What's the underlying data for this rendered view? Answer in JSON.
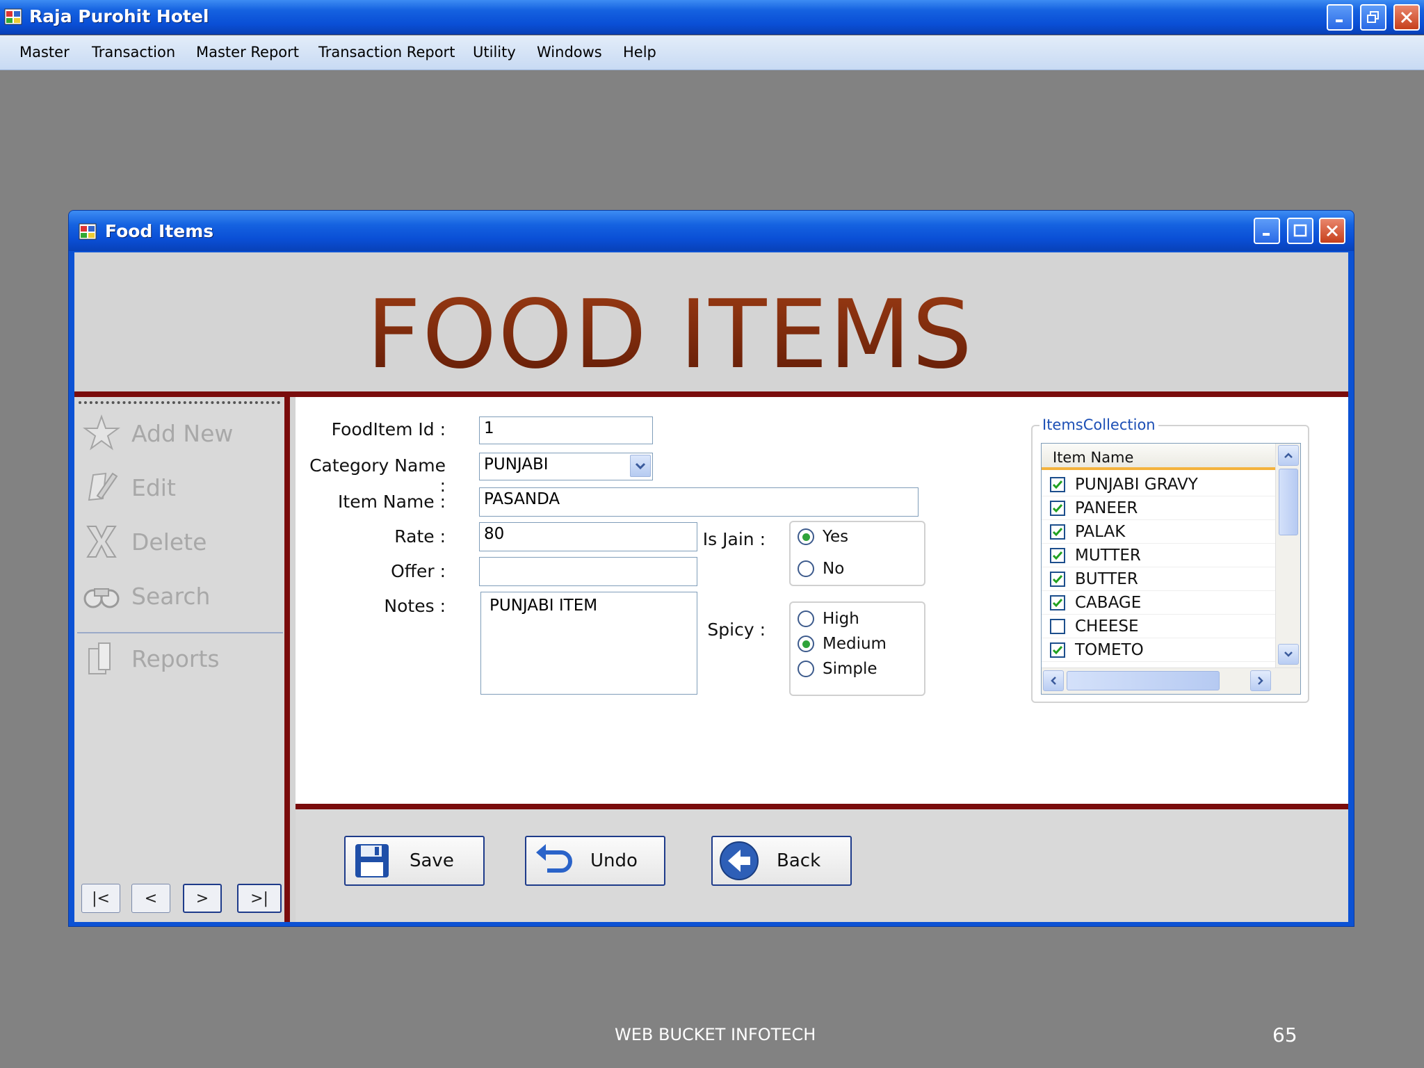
{
  "app": {
    "title": "Raja Purohit Hotel",
    "menu": [
      "Master",
      "Transaction",
      "Master Report",
      "Transaction Report",
      "Utility",
      "Windows",
      "Help"
    ]
  },
  "window": {
    "title": "Food Items",
    "banner": "FOOD ITEMS"
  },
  "sidebar": {
    "items": [
      {
        "label": "Add New",
        "icon": "star-icon"
      },
      {
        "label": "Edit",
        "icon": "pencil-icon"
      },
      {
        "label": "Delete",
        "icon": "delete-x-icon"
      },
      {
        "label": "Search",
        "icon": "binoculars-icon"
      },
      {
        "label": "Reports",
        "icon": "reports-icon"
      }
    ],
    "nav": [
      "|<",
      "<",
      ">",
      ">|"
    ]
  },
  "form": {
    "fooditem_id_label": "FoodItem Id :",
    "fooditem_id_value": "1",
    "category_label": "Category  Name :",
    "category_value": "PUNJABI",
    "item_name_label": "Item Name :",
    "item_name_value": "PASANDA",
    "rate_label": "Rate :",
    "rate_value": "80",
    "offer_label": "Offer :",
    "offer_value": "",
    "notes_label": "Notes :",
    "notes_value": "PUNJABI ITEM",
    "is_jain_label": "Is Jain :",
    "is_jain_options": [
      "Yes",
      "No"
    ],
    "is_jain_selected": "Yes",
    "spicy_label": "Spicy :",
    "spicy_options": [
      "High",
      "Medium",
      "Simple"
    ],
    "spicy_selected": "Medium"
  },
  "items_collection": {
    "legend": "ItemsCollection",
    "column": "Item Name",
    "items": [
      {
        "name": "PUNJABI GRAVY",
        "checked": true
      },
      {
        "name": "PANEER",
        "checked": true
      },
      {
        "name": "PALAK",
        "checked": true
      },
      {
        "name": "MUTTER",
        "checked": true
      },
      {
        "name": "BUTTER",
        "checked": true
      },
      {
        "name": "CABAGE",
        "checked": true
      },
      {
        "name": "CHEESE",
        "checked": false
      },
      {
        "name": "TOMETO",
        "checked": true
      }
    ]
  },
  "buttons": {
    "save": "Save",
    "undo": "Undo",
    "back": "Back"
  },
  "footer": {
    "company": "WEB BUCKET INFOTECH",
    "page": "65"
  },
  "colors": {
    "titlebar": "#0a4fd6",
    "accent_rule": "#7a0c0c",
    "banner_text": "#7c2a0e",
    "desktop": "#828282"
  }
}
